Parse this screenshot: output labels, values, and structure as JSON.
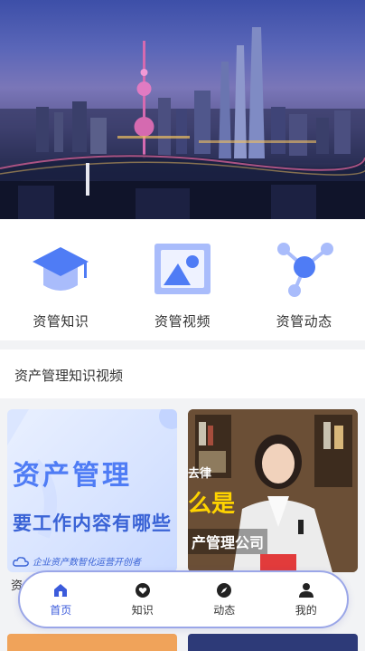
{
  "quick_nav": [
    {
      "label": "资管知识",
      "icon": "graduation-cap-icon"
    },
    {
      "label": "资管视频",
      "icon": "image-icon"
    },
    {
      "label": "资管动态",
      "icon": "share-nodes-icon"
    }
  ],
  "section": {
    "title": "资产管理知识视频"
  },
  "cards": {
    "left": {
      "title": "资产管理",
      "subtitle": "要工作内容有哪些",
      "brand": "企业资产数智化运营开创者",
      "caption": "资"
    },
    "right": {
      "text1": "去律",
      "text2": "么是",
      "text3": "产管理公司"
    }
  },
  "tabbar": [
    {
      "label": "首页",
      "icon": "home-icon",
      "active": true
    },
    {
      "label": "知识",
      "icon": "heart-icon",
      "active": false
    },
    {
      "label": "动态",
      "icon": "compass-icon",
      "active": false
    },
    {
      "label": "我的",
      "icon": "user-icon",
      "active": false
    }
  ],
  "colors": {
    "accent": "#3b5bdb",
    "icon_blue": "#4f7cf5",
    "icon_light": "#a9bcfb"
  }
}
